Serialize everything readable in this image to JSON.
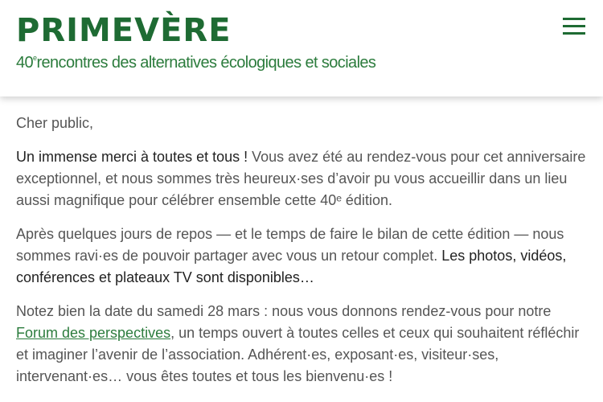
{
  "header": {
    "logo": "PRIMEVÈRE",
    "tagline_number": "40",
    "tagline_sup": "e",
    "tagline_text": "rencontres des alternatives écologiques et sociales",
    "menu_icon": "hamburger-menu-icon"
  },
  "colors": {
    "brand_green": "#1e6b33",
    "link_green": "#2c7c3d"
  },
  "article": {
    "greeting": "Cher public,",
    "p1_strong": "Un immense merci à toutes et tous !",
    "p1_text": " Vous avez été au rendez-vous pour cet anniversaire exceptionnel, et nous sommes très heureux·ses d’avoir pu vous accueillir dans un lieu aussi magnifique pour célébrer ensemble cette 40ᵉ édition.",
    "p2_text": "Après quelques jours de repos — et le temps de faire le bilan de cette édition — nous sommes ravi·es de pouvoir partager avec vous un retour complet. ",
    "p2_strong": "Les photos, vidéos, conférences et plateaux TV sont disponibles…",
    "p3_text_before": "Notez bien la date du samedi 28 mars : nous vous donnons rendez-vous pour notre ",
    "p3_link": "Forum des perspectives",
    "p3_text_after": ", un temps ouvert à toutes celles et ceux qui souhaitent réfléchir et imaginer l’avenir de l’association. Adhérent·es, exposant·es, visiteur·ses, intervenant·es… vous êtes toutes et tous les bienvenu·es !"
  }
}
